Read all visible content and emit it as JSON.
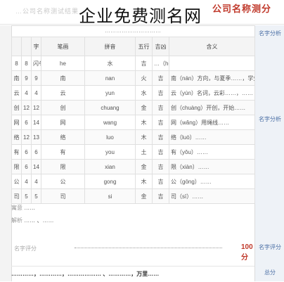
{
  "overlay_title": "企业免费测名网",
  "stamp_text": "公司名称测分",
  "header_faded": "…公司名称测试结果…",
  "subhead": "…………………………",
  "table": {
    "columns": [
      "字",
      "笔画",
      "拼音",
      "五行",
      "吉凶",
      "含义"
    ],
    "rows": [
      [
        "8",
        "8",
        "闪冬",
        "he",
        "水",
        "吉",
        "…（he）也可指……和谐，统合，……"
      ],
      [
        "南",
        "9",
        "9",
        "南",
        "nan",
        "火",
        "吉",
        "南（nán）方向，与夏季……，学生……"
      ],
      [
        "云",
        "4",
        "4",
        "云",
        "yun",
        "水",
        "吉",
        "云（yún）名词，云彩……，……"
      ],
      [
        "创",
        "12",
        "12",
        "创",
        "chuang",
        "金",
        "吉",
        "创（chuàng）开创，开始……"
      ],
      [
        "网",
        "6",
        "14",
        "网",
        "wang",
        "木",
        "吉",
        "网（wǎng）用绳线……"
      ],
      [
        "络",
        "12",
        "13",
        "络",
        "luo",
        "木",
        "吉",
        "络（luò）……"
      ],
      [
        "有",
        "6",
        "6",
        "有",
        "you",
        "土",
        "吉",
        "有（yǒu）……"
      ],
      [
        "限",
        "6",
        "14",
        "限",
        "xian",
        "金",
        "吉",
        "限（xiàn）……"
      ],
      [
        "公",
        "4",
        "4",
        "公",
        "gong",
        "木",
        "吉",
        "公（gōng）……"
      ],
      [
        "司",
        "5",
        "5",
        "司",
        "si",
        "金",
        "吉",
        "司（sī）……"
      ]
    ]
  },
  "right_labels": [
    "名字分析",
    "名字分析",
    "名字评分",
    "总分"
  ],
  "summary_rows": [
    {
      "key": "寓意",
      "value": "……"
    },
    {
      "key": "解析",
      "value": "…… 、……"
    }
  ],
  "score_label": "名字评分",
  "score_value": "100 分",
  "footer": "…………，…………，……………… 、…………，万里……"
}
